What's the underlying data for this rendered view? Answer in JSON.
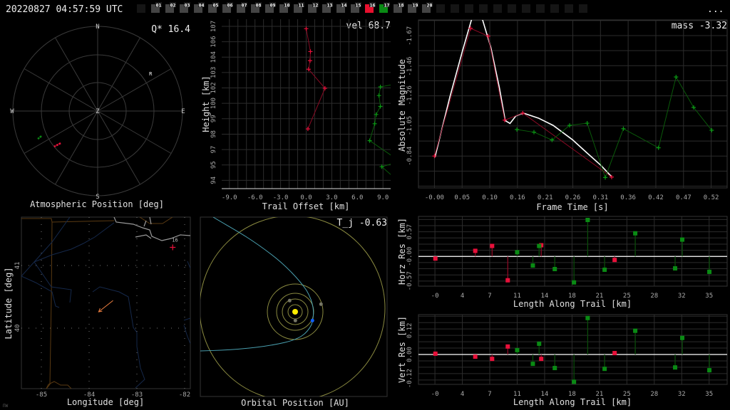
{
  "header": {
    "timestamp": "20220827 04:57:59 UTC",
    "more_label": "...",
    "stations": [
      {
        "label": "01",
        "state": "idle"
      },
      {
        "label": "02",
        "state": "idle"
      },
      {
        "label": "03",
        "state": "idle"
      },
      {
        "label": "04",
        "state": "idle"
      },
      {
        "label": "05",
        "state": "idle"
      },
      {
        "label": "06",
        "state": "idle"
      },
      {
        "label": "07",
        "state": "idle"
      },
      {
        "label": "08",
        "state": "idle"
      },
      {
        "label": "09",
        "state": "idle"
      },
      {
        "label": "10",
        "state": "idle"
      },
      {
        "label": "11",
        "state": "idle"
      },
      {
        "label": "12",
        "state": "idle"
      },
      {
        "label": "13",
        "state": "idle"
      },
      {
        "label": "14",
        "state": "idle"
      },
      {
        "label": "15",
        "state": "idle"
      },
      {
        "label": "16",
        "state": "red"
      },
      {
        "label": "17",
        "state": "green"
      },
      {
        "label": "18",
        "state": "idle"
      },
      {
        "label": "19",
        "state": "idle"
      },
      {
        "label": "20",
        "state": "idle"
      }
    ],
    "colors": {
      "idle": "#444444",
      "red": "#e8102e",
      "green": "#0a8a14",
      "empty": "#151515"
    }
  },
  "polar": {
    "title": "Atmospheric Position [deg]",
    "annotation": "Q* 16.4",
    "labels": {
      "n": "N",
      "s": "S",
      "e": "E",
      "w": "W",
      "z": "Z",
      "r": "R"
    },
    "r_marker": {
      "az": 54.4,
      "zd": 69
    },
    "tracks": [
      {
        "station": "16",
        "color": "#e8103a",
        "start": {
          "az": 229,
          "zd": 52
        },
        "end": {
          "az": 230.7,
          "zd": 59.7
        }
      },
      {
        "station": "17",
        "color": "#0a8a14",
        "start": {
          "az": 246,
          "zd": 65.3
        },
        "end": {
          "az": 245,
          "zd": 70
        }
      }
    ]
  },
  "map": {
    "xlabel": "Longitude [deg]",
    "ylabel": "Latitude [deg]",
    "x_ticks": [
      {
        "v": -85,
        "label": "-85"
      },
      {
        "v": -84,
        "label": "-84"
      },
      {
        "v": -83,
        "label": "-83"
      },
      {
        "v": -82,
        "label": "-82"
      }
    ],
    "y_ticks": [
      {
        "v": 41,
        "label": "41"
      },
      {
        "v": 40,
        "label": "40"
      }
    ],
    "station": {
      "label": "16",
      "lon": -82.25,
      "lat": 41.29
    },
    "track": {
      "start": {
        "lon": -83.5,
        "lat": 40.44
      },
      "end": {
        "lon": -83.8,
        "lat": 40.26
      },
      "color": "#f08040"
    },
    "corner_mark": "ПW"
  },
  "orbit": {
    "title": "Orbital Position [AU]",
    "annotation": "T_j -0.63"
  },
  "chart_data": [
    {
      "id": "height",
      "type": "line",
      "title": "",
      "annotation": "vel 68.7",
      "xlabel": "Trail Offset [km]",
      "ylabel": "Height [km]",
      "xlim": [
        -9.9,
        9.9
      ],
      "ylim": [
        93.5,
        107.8
      ],
      "x_ticks": [
        {
          "v": -9,
          "label": "-9.0"
        },
        {
          "v": -6,
          "label": "-6.0"
        },
        {
          "v": -3,
          "label": "-3.0"
        },
        {
          "v": 0,
          "label": "0.0"
        },
        {
          "v": 3,
          "label": "3.0"
        },
        {
          "v": 6,
          "label": "6.0"
        },
        {
          "v": 9,
          "label": "9.0"
        }
      ],
      "y_ticks": [
        {
          "v": 94.2,
          "label": "94"
        },
        {
          "v": 95.5,
          "label": "95"
        },
        {
          "v": 96.8,
          "label": "97"
        },
        {
          "v": 98.1,
          "label": "98"
        },
        {
          "v": 99.4,
          "label": "99"
        },
        {
          "v": 100.7,
          "label": "100"
        },
        {
          "v": 102.0,
          "label": "102"
        },
        {
          "v": 103.3,
          "label": "103"
        },
        {
          "v": 104.6,
          "label": "104"
        },
        {
          "v": 105.9,
          "label": "106"
        },
        {
          "v": 107.2,
          "label": "107"
        }
      ],
      "series": [
        {
          "name": "16",
          "color": "#e8103a",
          "line": "#8a0a24",
          "points": [
            [
              0.0,
              107.0
            ],
            [
              0.5,
              105.07
            ],
            [
              0.45,
              104.3
            ],
            [
              0.28,
              103.58
            ],
            [
              2.2,
              101.97
            ],
            [
              0.2,
              98.54
            ]
          ]
        },
        {
          "name": "17",
          "color": "#0a9a14",
          "line": "#0a5a0a",
          "points": [
            [
              11,
              102.4
            ],
            [
              8.7,
              102.09
            ],
            [
              8.53,
              101.36
            ],
            [
              8.7,
              100.44
            ],
            [
              8.2,
              99.76
            ],
            [
              8.03,
              98.98
            ],
            [
              7.44,
              97.55
            ],
            [
              11,
              95.8
            ],
            [
              8.86,
              95.35
            ],
            [
              11,
              94.0
            ]
          ]
        }
      ]
    },
    {
      "id": "magnitude",
      "type": "line",
      "annotation": "mass -3.32",
      "xlabel": "Frame Time [s]",
      "ylabel": "Absolute Magnitude",
      "xlim": [
        -0.03,
        0.55
      ],
      "ylim": [
        -0.62,
        -1.78
      ],
      "x_ticks": [
        {
          "v": 0,
          "label": "-0.00"
        },
        {
          "v": 0.052,
          "label": "0.05"
        },
        {
          "v": 0.104,
          "label": "0.10"
        },
        {
          "v": 0.156,
          "label": "0.16"
        },
        {
          "v": 0.208,
          "label": "0.21"
        },
        {
          "v": 0.26,
          "label": "0.26"
        },
        {
          "v": 0.312,
          "label": "0.31"
        },
        {
          "v": 0.364,
          "label": "0.36"
        },
        {
          "v": 0.416,
          "label": "0.42"
        },
        {
          "v": 0.468,
          "label": "0.47"
        },
        {
          "v": 0.52,
          "label": "0.52"
        }
      ],
      "y_ticks": [
        {
          "v": -0.84,
          "label": "-0.84"
        },
        {
          "v": -1.05,
          "label": "-1.05"
        },
        {
          "v": -1.26,
          "label": "-1.26"
        },
        {
          "v": -1.46,
          "label": "-1.46"
        },
        {
          "v": -1.67,
          "label": "-1.67"
        }
      ],
      "fit": [
        [
          0.001,
          -0.832
        ],
        [
          0.029,
          -1.248
        ],
        [
          0.052,
          -1.557
        ],
        [
          0.07,
          -1.786
        ],
        [
          0.08,
          -1.835
        ],
        [
          0.09,
          -1.786
        ],
        [
          0.106,
          -1.59
        ],
        [
          0.122,
          -1.313
        ],
        [
          0.133,
          -1.085
        ],
        [
          0.142,
          -1.065
        ],
        [
          0.153,
          -1.117
        ],
        [
          0.167,
          -1.137
        ],
        [
          0.196,
          -1.101
        ],
        [
          0.223,
          -1.052
        ],
        [
          0.259,
          -0.954
        ],
        [
          0.286,
          -0.864
        ],
        [
          0.313,
          -0.775
        ],
        [
          0.333,
          -0.697
        ]
      ],
      "series": [
        {
          "name": "16",
          "color": "#e8103a",
          "line": "#8a0a24",
          "points": [
            [
              0.0,
              -0.84
            ],
            [
              0.068,
              -1.722
            ],
            [
              0.101,
              -1.668
            ],
            [
              0.132,
              -1.088
            ],
            [
              0.166,
              -1.137
            ],
            [
              0.333,
              -0.695
            ]
          ]
        },
        {
          "name": "17",
          "color": "#0a9a14",
          "line": "#0a5a0a",
          "points": [
            [
              0.155,
              -1.023
            ],
            [
              0.187,
              -1.005
            ],
            [
              0.221,
              -0.951
            ],
            [
              0.254,
              -1.052
            ],
            [
              0.287,
              -1.067
            ],
            [
              0.321,
              -0.692
            ],
            [
              0.355,
              -1.029
            ],
            [
              0.421,
              -0.897
            ],
            [
              0.454,
              -1.386
            ],
            [
              0.487,
              -1.176
            ],
            [
              0.521,
              -1.018
            ]
          ]
        }
      ]
    },
    {
      "id": "horz_res",
      "type": "scatter",
      "xlabel": "Length Along Trail [km]",
      "ylabel": "Horz Res [km]",
      "xlim": [
        -2.1,
        37.3
      ],
      "ylim": [
        -0.69,
        0.93
      ],
      "x_ticks": [
        {
          "v": 0,
          "label": "-0"
        },
        {
          "v": 3.5,
          "label": "4"
        },
        {
          "v": 7,
          "label": "7"
        },
        {
          "v": 10.5,
          "label": "11"
        },
        {
          "v": 14,
          "label": "14"
        },
        {
          "v": 17.5,
          "label": "18"
        },
        {
          "v": 21,
          "label": "21"
        },
        {
          "v": 24.5,
          "label": "25"
        },
        {
          "v": 28,
          "label": "28"
        },
        {
          "v": 31.5,
          "label": "32"
        },
        {
          "v": 35,
          "label": "35"
        }
      ],
      "y_ticks": [
        {
          "v": 0.57,
          "label": "0.57"
        },
        {
          "v": 0,
          "label": "-0.00"
        },
        {
          "v": -0.57,
          "label": "-0.57"
        }
      ],
      "series": [
        {
          "name": "16",
          "color": "#e8103a",
          "line": "#8a0a24",
          "points": [
            [
              0.06,
              -0.049
            ],
            [
              5.15,
              0.13
            ],
            [
              7.3,
              0.244
            ],
            [
              9.3,
              -0.554
            ],
            [
              13.57,
              0.26
            ],
            [
              22.94,
              -0.081
            ]
          ]
        },
        {
          "name": "17",
          "color": "#0a8a14",
          "line": "#0a4a0a",
          "points": [
            [
              10.5,
              0.098
            ],
            [
              12.5,
              -0.212
            ],
            [
              13.3,
              0.244
            ],
            [
              15.3,
              -0.293
            ],
            [
              17.75,
              -0.603
            ],
            [
              19.5,
              0.847
            ],
            [
              21.66,
              -0.309
            ],
            [
              25.57,
              0.537
            ],
            [
              30.66,
              -0.277
            ],
            [
              31.57,
              0.391
            ],
            [
              35.03,
              -0.358
            ]
          ]
        }
      ]
    },
    {
      "id": "vert_res",
      "type": "scatter",
      "xlabel": "Length Along Trail [km]",
      "ylabel": "Vert Res [km]",
      "xlim": [
        -2.1,
        37.3
      ],
      "ylim": [
        -0.15,
        0.2
      ],
      "x_ticks": [
        {
          "v": 0,
          "label": "-0"
        },
        {
          "v": 3.5,
          "label": "4"
        },
        {
          "v": 7,
          "label": "7"
        },
        {
          "v": 10.5,
          "label": "11"
        },
        {
          "v": 14,
          "label": "14"
        },
        {
          "v": 17.5,
          "label": "18"
        },
        {
          "v": 21,
          "label": "21"
        },
        {
          "v": 24.5,
          "label": "25"
        },
        {
          "v": 28,
          "label": "28"
        },
        {
          "v": 31.5,
          "label": "32"
        },
        {
          "v": 35,
          "label": "35"
        }
      ],
      "y_ticks": [
        {
          "v": 0.12,
          "label": "0.12"
        },
        {
          "v": 0,
          "label": "0.00"
        },
        {
          "v": -0.12,
          "label": "-0.12"
        }
      ],
      "series": [
        {
          "name": "16",
          "color": "#e8103a",
          "line": "#8a0a24",
          "points": [
            [
              0.06,
              0.004
            ],
            [
              5.15,
              -0.011
            ],
            [
              7.3,
              -0.022
            ],
            [
              9.3,
              0.04
            ],
            [
              13.57,
              -0.022
            ],
            [
              22.94,
              0.007
            ]
          ]
        },
        {
          "name": "17",
          "color": "#0a8a14",
          "line": "#0a4a0a",
          "points": [
            [
              10.5,
              0.022
            ],
            [
              12.5,
              -0.047
            ],
            [
              13.3,
              0.054
            ],
            [
              15.3,
              -0.068
            ],
            [
              17.75,
              -0.137
            ],
            [
              19.5,
              0.183
            ],
            [
              21.66,
              -0.072
            ],
            [
              25.57,
              0.119
            ],
            [
              30.66,
              -0.065
            ],
            [
              31.57,
              0.083
            ],
            [
              35.03,
              -0.079
            ]
          ]
        }
      ]
    }
  ]
}
